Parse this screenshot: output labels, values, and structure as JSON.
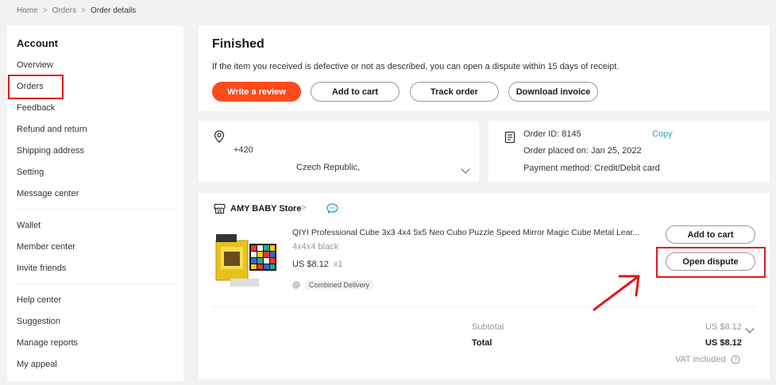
{
  "breadcrumb": {
    "home": "Home",
    "orders": "Orders",
    "current": "Order details",
    "sep": ">"
  },
  "sidebar": {
    "title": "Account",
    "items": [
      "Overview",
      "Orders",
      "Feedback",
      "Refund and return",
      "Shipping address",
      "Setting",
      "Message center",
      "Wallet",
      "Member center",
      "Invite friends",
      "Help center",
      "Suggestion",
      "Manage reports",
      "My appeal"
    ]
  },
  "status": {
    "title": "Finished",
    "desc": "If the item you received is defective or not as described, you can open a dispute within 15 days of receipt.",
    "buttons": {
      "review": "Write a review",
      "cart": "Add to cart",
      "track": "Track order",
      "invoice": "Download invoice"
    }
  },
  "address": {
    "phone": "+420",
    "country": "Czech Republic,"
  },
  "order": {
    "id": "Order ID: 8145",
    "copy": "Copy",
    "placed": "Order placed on: Jan 25, 2022",
    "payment": "Payment method: Credit/Debit card"
  },
  "store": {
    "name": "AMY BABY Store",
    "chevron": ">"
  },
  "product": {
    "title": "QIYI Professional Cube 3x3 4x4 5x5 Neo Cubo Puzzle Speed Mirror Magic Cube Metal Lear...",
    "variant": "4x4x4 black",
    "price": "US $8.12",
    "qty": "x1",
    "delivery": "Combined Delivery",
    "add_to_cart": "Add to cart",
    "open_dispute": "Open dispute"
  },
  "summary": {
    "subtotal_label": "Subtotal",
    "subtotal_value": "US $8.12",
    "total_label": "Total",
    "total_value": "US $8.12",
    "vat": "VAT included"
  },
  "colors": {
    "accent": "#fd4b1c",
    "annotation_red": "#e0171c",
    "link": "#2e9cc3"
  }
}
